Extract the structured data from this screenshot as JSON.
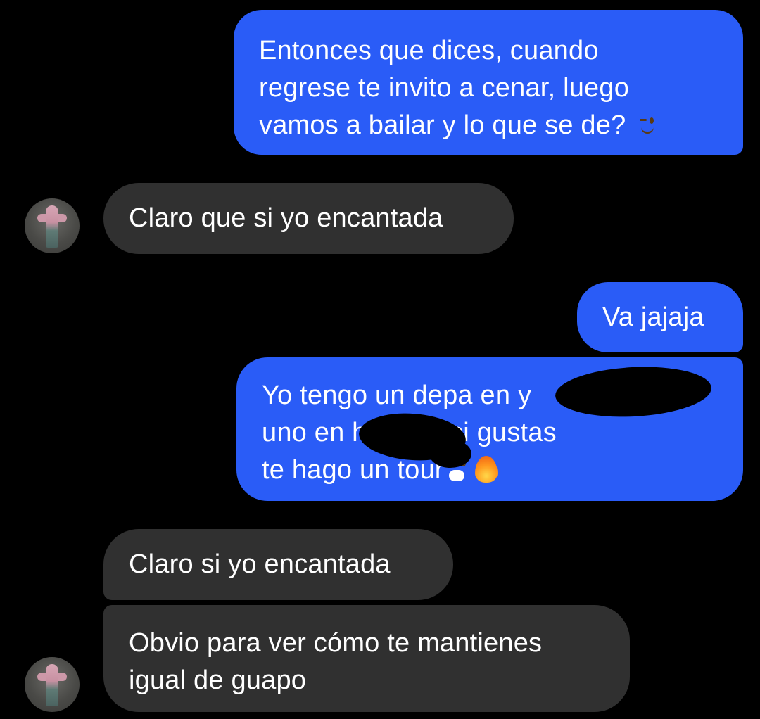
{
  "conversation": {
    "messages": [
      {
        "sender": "me",
        "text": "Entonces que dices, cuando\nregrese te invito a cenar, luego\nvamos a bailar y lo que se de?",
        "emoji": [
          "winking-face"
        ]
      },
      {
        "sender": "contact",
        "text": "Claro que si yo encantada"
      },
      {
        "sender": "me",
        "text": "Va jajaja"
      },
      {
        "sender": "me",
        "text": "Yo tengo un depa en                           y\nuno en                        hay por si gustas\nte hago un tour",
        "emoji": [
          "face-with-hand-over-mouth",
          "fire"
        ],
        "redacted": true
      },
      {
        "sender": "contact",
        "text": "Claro si yo encantada"
      },
      {
        "sender": "contact",
        "text": "Obvio para ver cómo te mantienes\nigual de guapo"
      }
    ]
  },
  "colors": {
    "background": "#000000",
    "outgoing_bubble": "#2a5cf7",
    "incoming_bubble": "#303030",
    "text": "#ffffff"
  }
}
